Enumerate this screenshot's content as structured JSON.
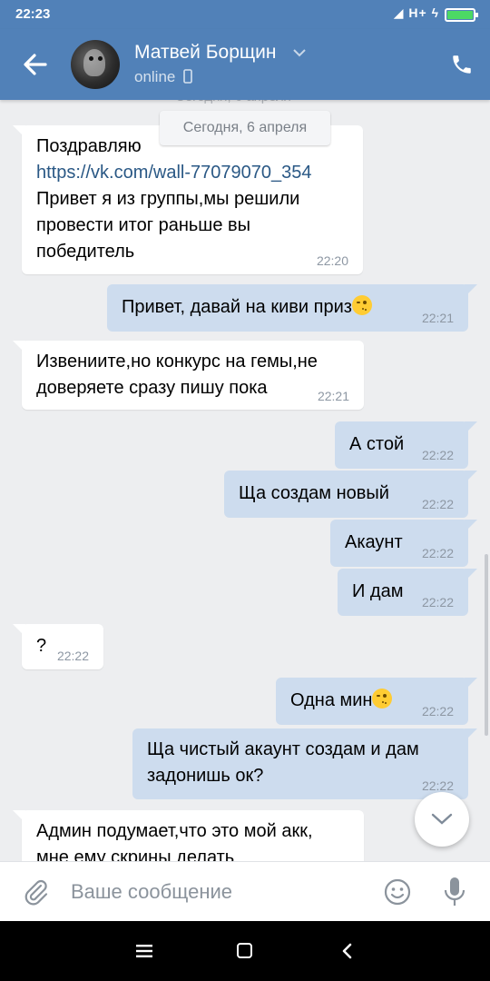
{
  "status_bar": {
    "time": "22:23",
    "signal": "H+"
  },
  "header": {
    "contact_name": "Матвей Борщин",
    "status": "online"
  },
  "chat": {
    "date_label": "Сегодня, 6 апреля",
    "messages": [
      {
        "dir": "in",
        "lines": [
          "Поздравляю"
        ],
        "link": "https://vk.com/wall-77079070_354",
        "lines_after": [
          "Привет я из группы,мы решили",
          "провести итог раньше вы",
          "победитель"
        ],
        "time": "22:20"
      },
      {
        "dir": "out",
        "text": "Привет, давай на киви приз",
        "emoji": "wink",
        "time": "22:21"
      },
      {
        "dir": "in",
        "lines": [
          "Извениите,но конкурс на гемы,не",
          "доверяете сразу пишу пока"
        ],
        "time": "22:21"
      },
      {
        "dir": "out",
        "text": "А стой",
        "time": "22:22"
      },
      {
        "dir": "out",
        "text": "Ща создам новый",
        "time": "22:22"
      },
      {
        "dir": "out",
        "text": "Акаунт",
        "time": "22:22"
      },
      {
        "dir": "out",
        "text": "И дам",
        "time": "22:22"
      },
      {
        "dir": "in",
        "text": "?",
        "time": "22:22"
      },
      {
        "dir": "out",
        "text": "Одна мин",
        "emoji": "wink",
        "time": "22:22"
      },
      {
        "dir": "out",
        "lines": [
          "Ща чистый акаунт создам и дам",
          "задонишь ок?"
        ],
        "time": "22:22"
      },
      {
        "dir": "in",
        "lines": [
          "Админ подумает,что это мой акк,",
          "мне ему скрины делать"
        ]
      }
    ]
  },
  "composer": {
    "placeholder": "Ваше сообщение"
  },
  "icons": {
    "back": "arrow-left-icon",
    "phone": "phone-icon",
    "device": "mobile-device-icon",
    "attach": "paperclip-icon",
    "emoji": "smiley-icon",
    "mic": "microphone-icon",
    "scroll_down": "chevron-down-icon"
  },
  "colors": {
    "header": "#5181b8",
    "outgoing_bubble": "#cddcee",
    "incoming_bubble": "#ffffff",
    "background": "#edeef0",
    "link": "#2a5885"
  }
}
